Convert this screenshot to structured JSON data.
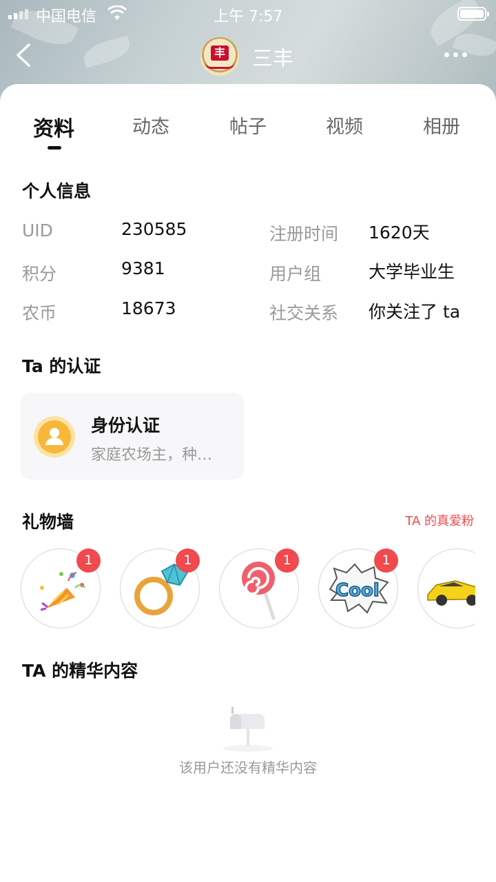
{
  "status_bar": {
    "carrier": "中国电信",
    "time": "上午 7:57"
  },
  "header": {
    "username": "三丰",
    "avatar_text": "丰"
  },
  "tabs": [
    {
      "label": "资料",
      "active": true
    },
    {
      "label": "动态",
      "active": false
    },
    {
      "label": "帖子",
      "active": false
    },
    {
      "label": "视频",
      "active": false
    },
    {
      "label": "相册",
      "active": false
    }
  ],
  "personal_info": {
    "title": "个人信息",
    "rows": [
      {
        "label": "UID",
        "value": "230585",
        "label2": "注册时间",
        "value2": "1620天"
      },
      {
        "label": "积分",
        "value": "9381",
        "label2": "用户组",
        "value2": "大学毕业生"
      },
      {
        "label": "农币",
        "value": "18673",
        "label2": "社交关系",
        "value2": "你关注了 ta"
      }
    ]
  },
  "certification": {
    "title": "Ta 的认证",
    "card_title": "身份认证",
    "card_subtitle": "家庭农场主，种…"
  },
  "gift_wall": {
    "title": "礼物墙",
    "fan_link": "TA 的真爱粉",
    "gifts": [
      {
        "icon": "party-popper-icon",
        "count": "1"
      },
      {
        "icon": "diamond-ring-icon",
        "count": "1"
      },
      {
        "icon": "lollipop-icon",
        "count": "1"
      },
      {
        "icon": "cool-sticker-icon",
        "count": "1"
      },
      {
        "icon": "sports-car-icon",
        "count": ""
      }
    ]
  },
  "featured": {
    "title": "TA 的精华内容",
    "empty_text": "该用户还没有精华内容"
  },
  "colors": {
    "accent_red": "#ef4b4b",
    "badge_red": "#f0494e",
    "cert_yellow": "#f8b739"
  }
}
